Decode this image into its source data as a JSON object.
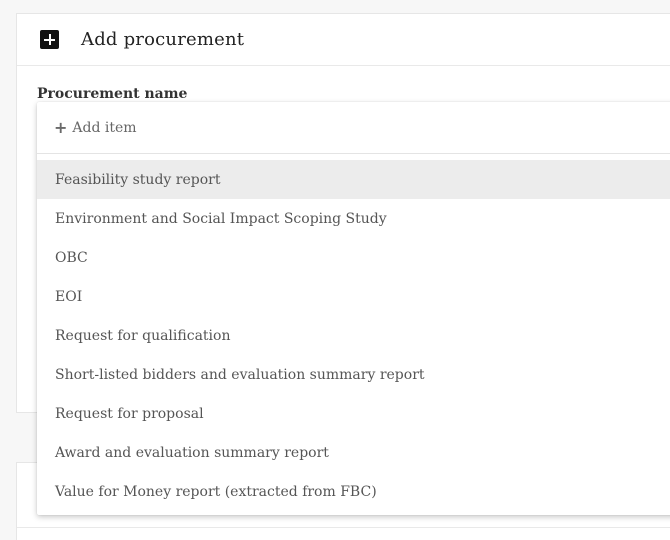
{
  "card": {
    "title": "Add procurement",
    "field_label": "Procurement name"
  },
  "dropdown": {
    "add_item_label": "Add item",
    "options": [
      "Feasibility study report",
      "Environment and Social Impact Scoping Study",
      "OBC",
      "EOI",
      "Request for qualification",
      "Short-listed bidders and evaluation summary report",
      "Request for proposal",
      "Award and evaluation summary report",
      "Value for Money report (extracted from FBC)"
    ],
    "highlighted_index": 0
  }
}
